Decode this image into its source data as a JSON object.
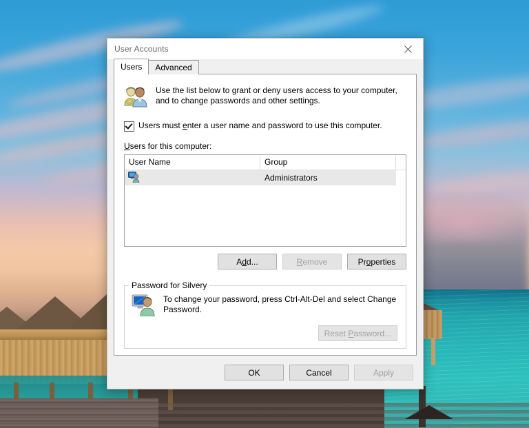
{
  "window": {
    "title": "User Accounts",
    "close_icon": "close-icon"
  },
  "tabs": [
    {
      "label": "Users",
      "active": true
    },
    {
      "label": "Advanced",
      "active": false
    }
  ],
  "intro": {
    "icon": "users-with-key-icon",
    "line1": "Use the list below to grant or deny users access to your computer,",
    "line2": "and to change passwords and other settings."
  },
  "checkbox": {
    "checked": true,
    "label_before": "Users must ",
    "label_accel": "e",
    "label_after": "nter a user name and password to use this computer."
  },
  "list": {
    "label_accel": "U",
    "label_rest": "sers for this computer:",
    "columns": [
      "User Name",
      "Group"
    ],
    "rows": [
      {
        "icon": "user-computer-icon",
        "user_name": "",
        "group": "Administrators",
        "selected": true
      }
    ]
  },
  "list_buttons": [
    {
      "name": "add-button",
      "before": "A",
      "accel": "d",
      "after": "d...",
      "disabled": false
    },
    {
      "name": "remove-button",
      "before": "",
      "accel": "R",
      "after": "emove",
      "disabled": true
    },
    {
      "name": "properties-button",
      "before": "Pr",
      "accel": "o",
      "after": "perties",
      "disabled": false
    }
  ],
  "password_group": {
    "legend": "Password for Silvery",
    "icon": "user-computer-icon",
    "line1": "To change your password, press Ctrl-Alt-Del and select Change",
    "line2": "Password.",
    "reset_button": {
      "before": "Reset ",
      "accel": "P",
      "after": "assword...",
      "disabled": true
    }
  },
  "footer_buttons": [
    {
      "name": "ok-button",
      "label": "OK",
      "disabled": false
    },
    {
      "name": "cancel-button",
      "label": "Cancel",
      "disabled": false
    },
    {
      "name": "apply-button",
      "label": "Apply",
      "disabled": true
    }
  ],
  "colors": {
    "dialog_bg": "#f0f0f0",
    "titlebar_bg": "#ffffff",
    "page_bg": "#ffffff",
    "selection_bg": "#e8e8e8",
    "disabled_text": "#a0a0a0",
    "accent": "#0078d7"
  }
}
